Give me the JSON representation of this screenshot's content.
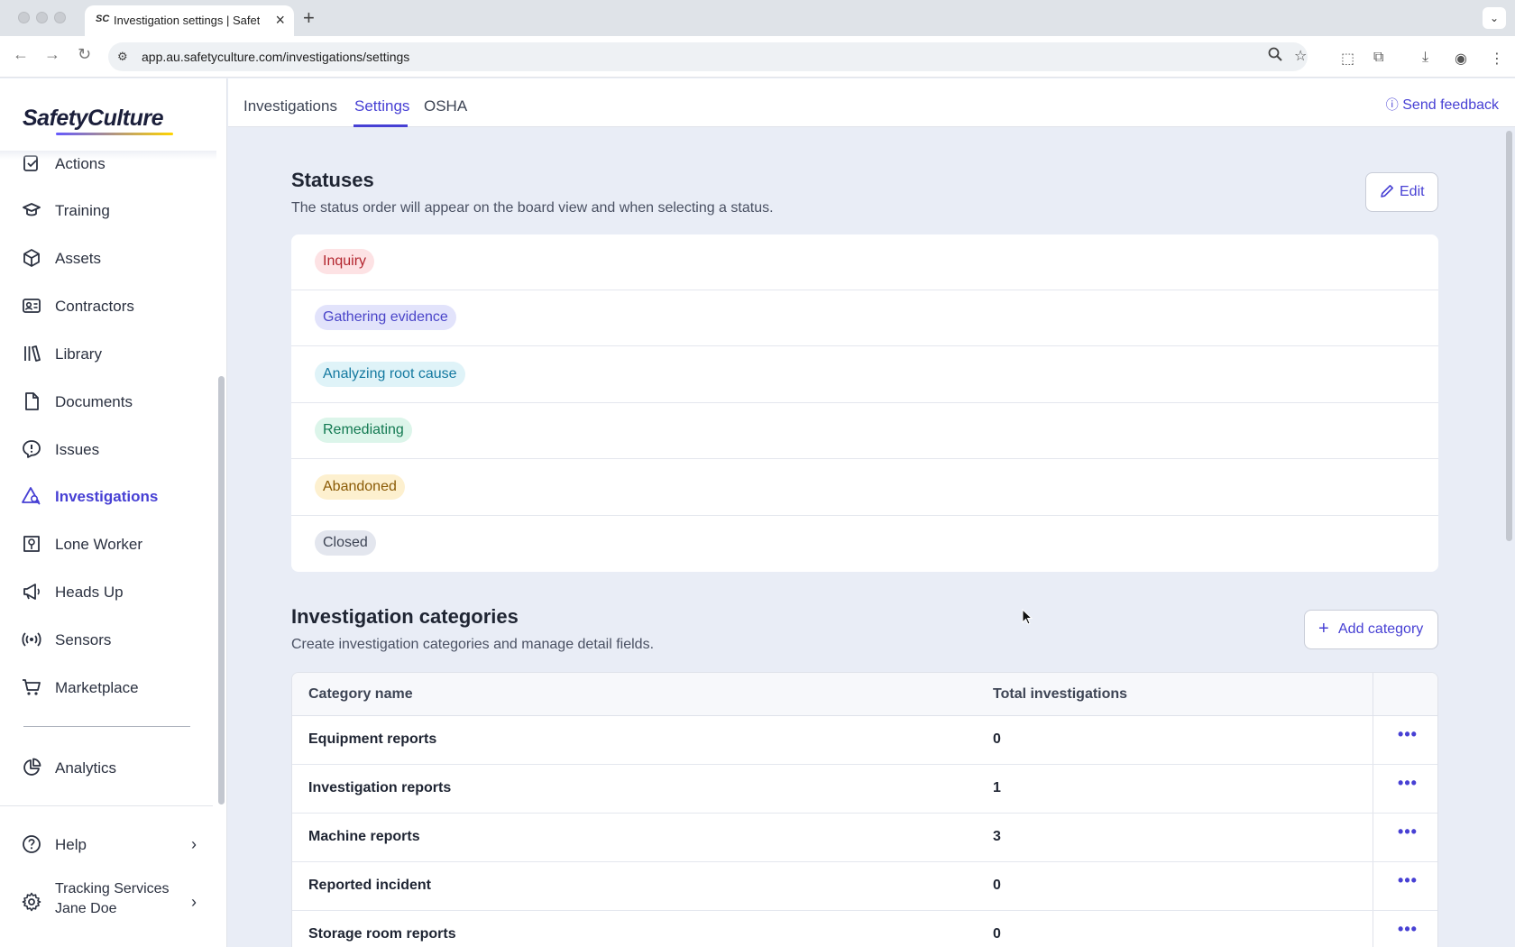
{
  "browser": {
    "tab_title": "Investigation settings | SafetyCulture",
    "favicon": "SC",
    "url": "app.au.safetyculture.com/investigations/settings"
  },
  "sidebar": {
    "logo": "SafetyCulture",
    "items": [
      {
        "label": "Actions",
        "icon": "actions-icon"
      },
      {
        "label": "Training",
        "icon": "training-icon"
      },
      {
        "label": "Assets",
        "icon": "assets-icon"
      },
      {
        "label": "Contractors",
        "icon": "contractors-icon"
      },
      {
        "label": "Library",
        "icon": "library-icon"
      },
      {
        "label": "Documents",
        "icon": "documents-icon"
      },
      {
        "label": "Issues",
        "icon": "issues-icon"
      },
      {
        "label": "Investigations",
        "icon": "investigations-icon",
        "active": true
      },
      {
        "label": "Lone Worker",
        "icon": "lone-worker-icon"
      },
      {
        "label": "Heads Up",
        "icon": "heads-up-icon"
      },
      {
        "label": "Sensors",
        "icon": "sensors-icon"
      },
      {
        "label": "Marketplace",
        "icon": "marketplace-icon"
      },
      {
        "label": "Analytics",
        "icon": "analytics-icon"
      }
    ],
    "help_label": "Help",
    "org_name": "Tracking Services",
    "user_name": "Jane Doe"
  },
  "topnav": {
    "tabs": [
      "Investigations",
      "Settings",
      "OSHA"
    ],
    "active_tab": "Settings",
    "feedback_label": "Send feedback"
  },
  "statuses": {
    "title": "Statuses",
    "description": "The status order will appear on the board view and when selecting a status.",
    "edit_label": "Edit",
    "items": [
      {
        "label": "Inquiry",
        "bg": "#fde2e4",
        "fg": "#b3262f"
      },
      {
        "label": "Gathering evidence",
        "bg": "#e2e3fb",
        "fg": "#4a45c9"
      },
      {
        "label": "Analyzing root cause",
        "bg": "#dff3f8",
        "fg": "#1479a0"
      },
      {
        "label": "Remediating",
        "bg": "#dcf5ea",
        "fg": "#137a52"
      },
      {
        "label": "Abandoned",
        "bg": "#fdf0cf",
        "fg": "#8a5a05"
      },
      {
        "label": "Closed",
        "bg": "#e3e6ee",
        "fg": "#3d4454"
      }
    ]
  },
  "categories": {
    "title": "Investigation categories",
    "description": "Create investigation categories and manage detail fields.",
    "add_label": "Add category",
    "columns": [
      "Category name",
      "Total investigations"
    ],
    "rows": [
      {
        "name": "Equipment reports",
        "total": "0"
      },
      {
        "name": "Investigation reports",
        "total": "1"
      },
      {
        "name": "Machine reports",
        "total": "3"
      },
      {
        "name": "Reported incident",
        "total": "0"
      },
      {
        "name": "Storage room reports",
        "total": "0"
      }
    ],
    "more_label": "•••"
  },
  "colors": {
    "accent": "#4740d4",
    "background": "#e9edf6"
  }
}
